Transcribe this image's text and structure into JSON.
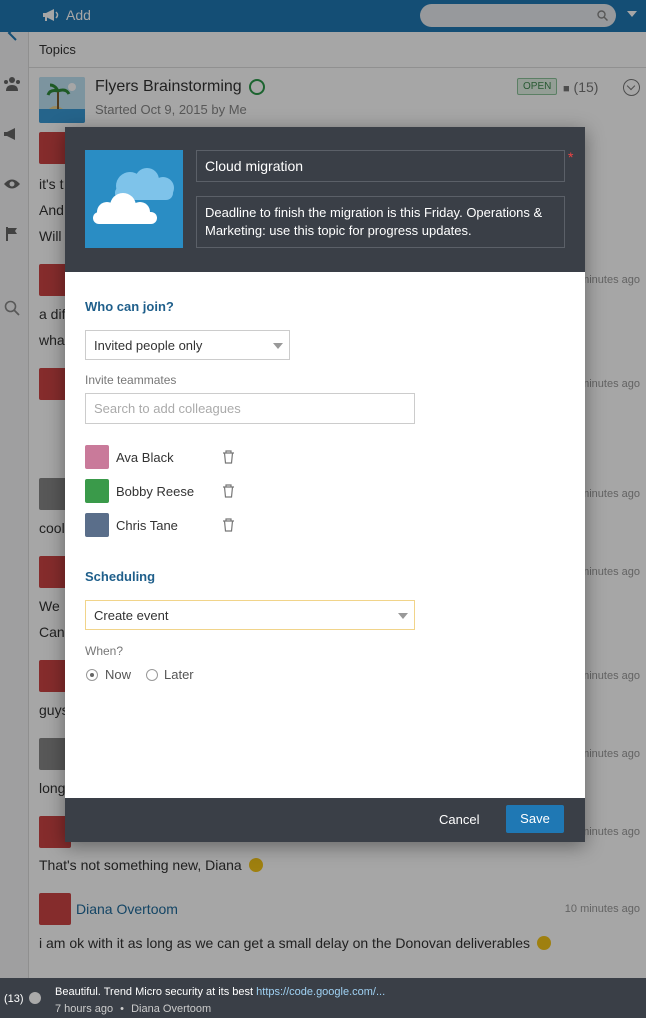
{
  "topbar": {
    "add_label": "Add",
    "search_placeholder": ""
  },
  "topics_header": "Topics",
  "topic": {
    "title": "Flyers Brainstorming",
    "subtitle": "Started Oct 9, 2015 by Me",
    "status": "OPEN",
    "reply_count": "(15)"
  },
  "feed": {
    "snippets": [
      "it's t",
      "And",
      "Will",
      "a dif",
      "wha",
      "cool",
      "We",
      "Can",
      "guys",
      "long"
    ],
    "times": [
      "minutes ago",
      "minutes ago",
      "minutes ago",
      "minutes ago",
      "minutes ago",
      "minutes ago",
      "minutes ago"
    ],
    "last_message_1": "That's not something new, Diana",
    "author_2": "Diana Overtoom",
    "time_2": "10 minutes ago",
    "last_message_2": "i am ok with it as long as we can get a small delay on the Donovan deliverables"
  },
  "modal": {
    "title_value": "Cloud migration",
    "required_mark": "*",
    "description_value": "Deadline to finish the migration is this Friday. Operations & Marketing: use this topic for progress updates.",
    "who_can_join_title": "Who can join?",
    "who_can_join_selected": "Invited people only",
    "invite_label": "Invite teammates",
    "invite_placeholder": "Search to add colleagues",
    "members": [
      {
        "name": "Ava Black"
      },
      {
        "name": "Bobby Reese"
      },
      {
        "name": "Chris Tane"
      }
    ],
    "scheduling_title": "Scheduling",
    "scheduling_selected": "Create event",
    "when_label": "When?",
    "radio_now": "Now",
    "radio_later": "Later",
    "cancel_label": "Cancel",
    "save_label": "Save"
  },
  "bottombar": {
    "count": "(13)",
    "message": "Beautiful. Trend Micro security at its best ",
    "link": "https://code.google.com/...",
    "time": "7 hours ago",
    "separator": "•",
    "author": "Diana Overtoom"
  },
  "colors": {
    "brand": "#1f78b4",
    "dark": "#3a3f47",
    "accent_link": "#1f6b9c"
  }
}
